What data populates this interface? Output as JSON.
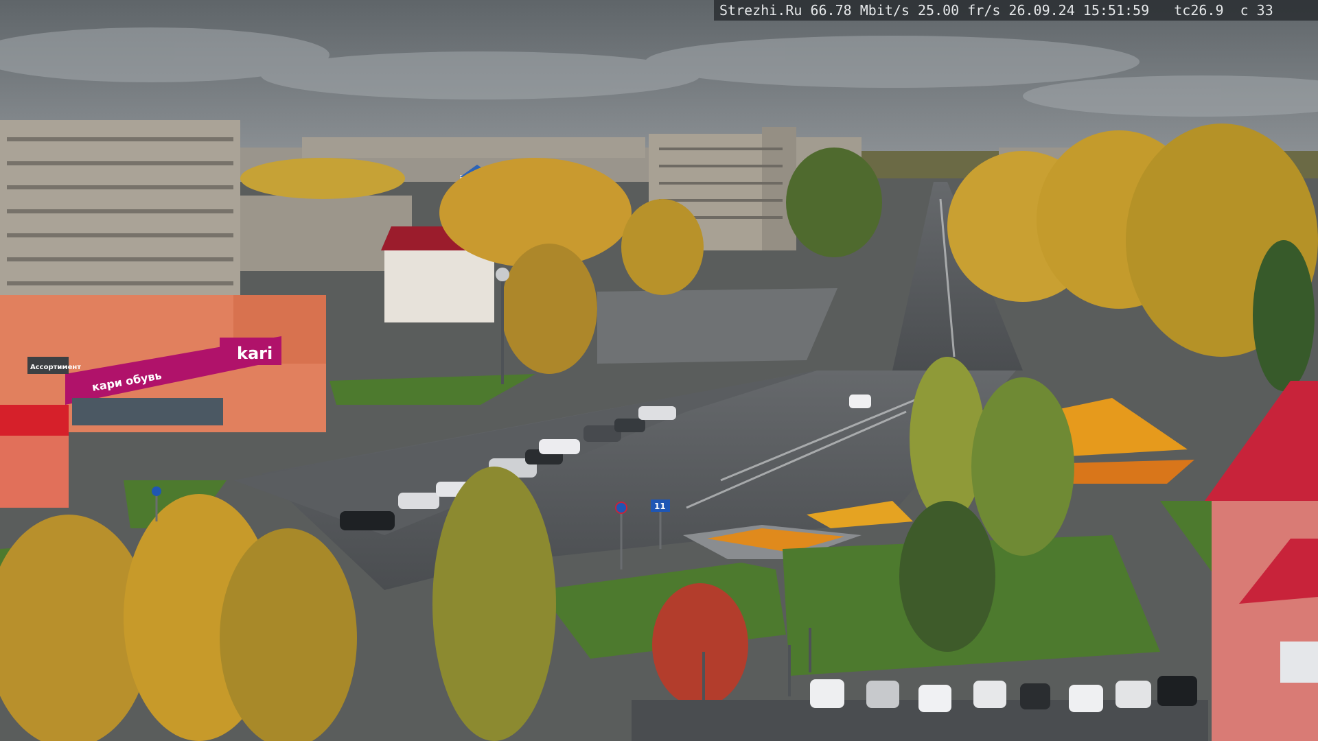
{
  "osd": {
    "text": "Strezhi.Ru 66.78 Mbit/s 25.00 fr/s 26.09.24 15:51:59   tc26.9  c 33"
  },
  "signs": {
    "store_logo": "kari",
    "store_banner": "кари обувь",
    "store_left": "Ассортимент",
    "sign_11": "11"
  },
  "palette": {
    "sky": "#7e8488",
    "sky_dark": "#5e6468",
    "asphalt": "#55585b",
    "grass": "#4d7a2e",
    "foliage_yellow": "#c79a2a",
    "foliage_green": "#5c7a2c",
    "store_orange": "#e1805e",
    "store_magenta": "#b0126a",
    "roof_red": "#c8233a",
    "panel_building": "#a49e93",
    "flowers": "#e08a1c"
  },
  "icons": [
    "road-sign-icon",
    "no-parking-icon"
  ]
}
